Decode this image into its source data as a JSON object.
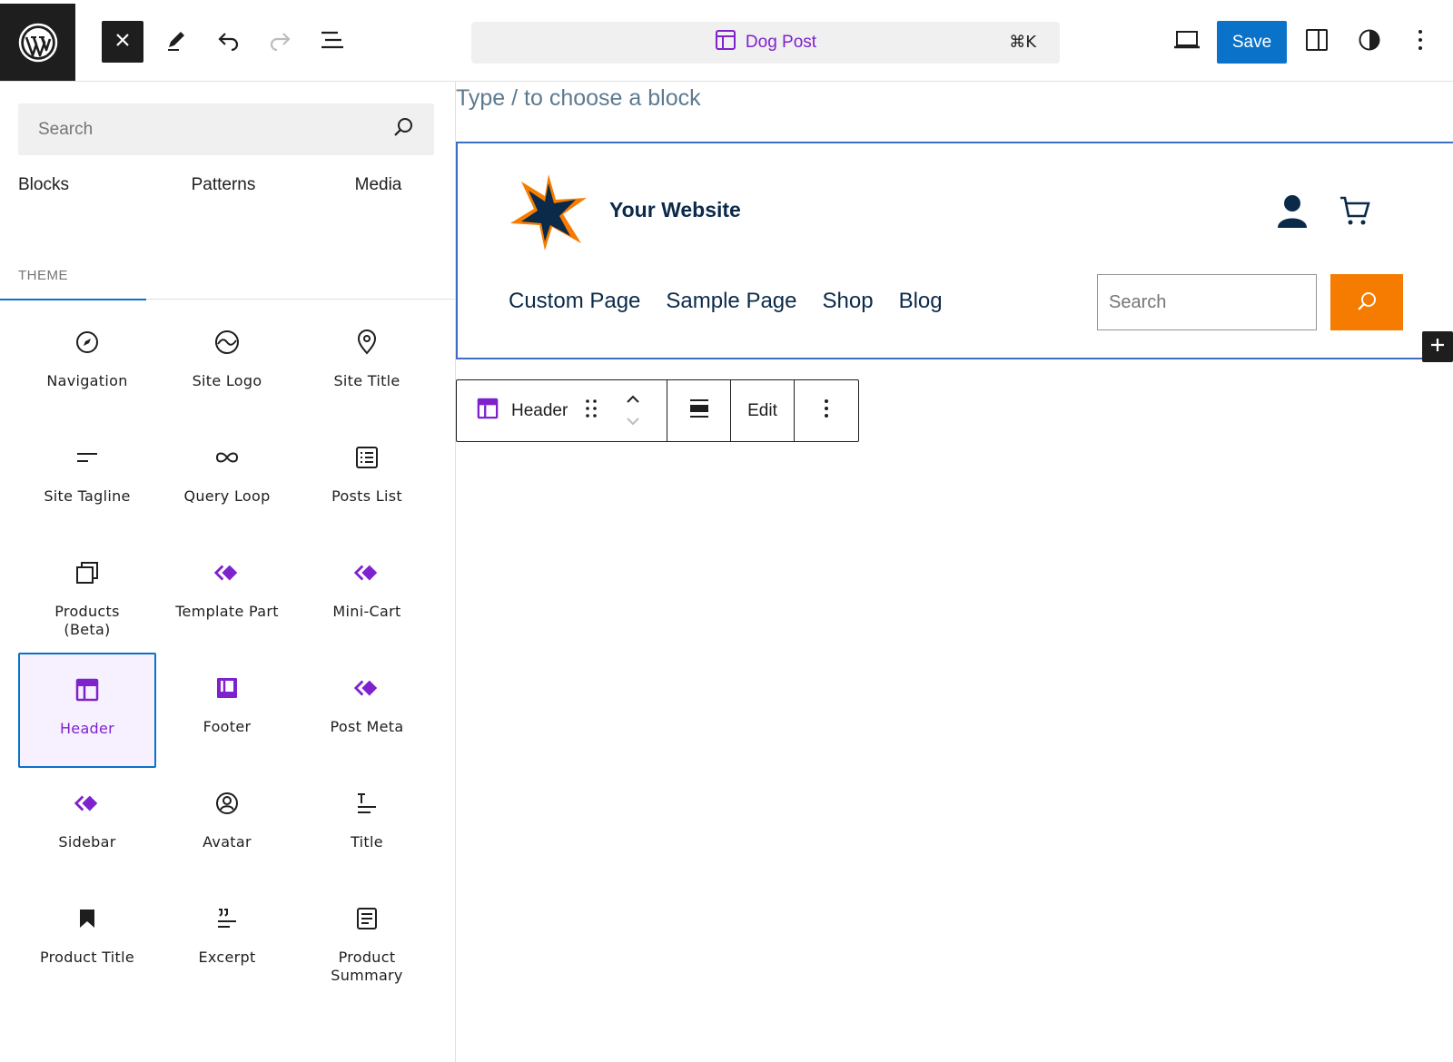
{
  "topbar": {
    "command_title": "Dog Post",
    "command_shortcut": "⌘K",
    "save_label": "Save"
  },
  "sidebar": {
    "search_placeholder": "Search",
    "tabs": [
      {
        "label": "Blocks"
      },
      {
        "label": "Patterns"
      },
      {
        "label": "Media"
      }
    ],
    "section_label": "THEME",
    "blocks": [
      {
        "label": "Navigation",
        "icon": "navigation-icon"
      },
      {
        "label": "Site Logo",
        "icon": "site-logo-icon"
      },
      {
        "label": "Site Title",
        "icon": "site-title-icon"
      },
      {
        "label": "Site Tagline",
        "icon": "site-tagline-icon"
      },
      {
        "label": "Query Loop",
        "icon": "query-loop-icon"
      },
      {
        "label": "Posts List",
        "icon": "posts-list-icon"
      },
      {
        "label": "Products (Beta)",
        "icon": "products-icon"
      },
      {
        "label": "Template Part",
        "icon": "template-part-icon"
      },
      {
        "label": "Mini-Cart",
        "icon": "mini-cart-icon"
      },
      {
        "label": "Header",
        "icon": "header-icon",
        "selected": true
      },
      {
        "label": "Footer",
        "icon": "footer-icon"
      },
      {
        "label": "Post Meta",
        "icon": "post-meta-icon"
      },
      {
        "label": "Sidebar",
        "icon": "sidebar-icon"
      },
      {
        "label": "Avatar",
        "icon": "avatar-icon"
      },
      {
        "label": "Title",
        "icon": "title-icon"
      },
      {
        "label": "Product Title",
        "icon": "product-title-icon"
      },
      {
        "label": "Excerpt",
        "icon": "excerpt-icon"
      },
      {
        "label": "Product Summary",
        "icon": "product-summary-icon"
      }
    ]
  },
  "canvas": {
    "placeholder": "Type / to choose a block",
    "site_title": "Your Website",
    "nav_links": [
      "Custom Page",
      "Sample Page",
      "Shop",
      "Blog"
    ],
    "search_placeholder": "Search"
  },
  "block_toolbar": {
    "block_name": "Header",
    "edit_label": "Edit"
  },
  "colors": {
    "accent_blue": "#0a73c9",
    "purple": "#7e22ce",
    "navy": "#0b2a4a",
    "orange": "#f57c00"
  }
}
